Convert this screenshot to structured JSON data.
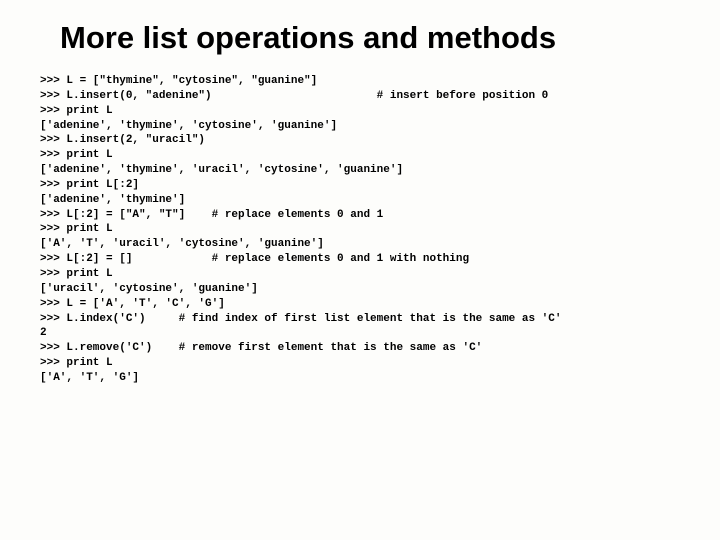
{
  "title": "More list operations and methods",
  "code": ">>> L = [\"thymine\", \"cytosine\", \"guanine\"]\n>>> L.insert(0, \"adenine\")                         # insert before position 0\n>>> print L\n['adenine', 'thymine', 'cytosine', 'guanine']\n>>> L.insert(2, \"uracil\")\n>>> print L\n['adenine', 'thymine', 'uracil', 'cytosine', 'guanine']\n>>> print L[:2]\n['adenine', 'thymine']\n>>> L[:2] = [\"A\", \"T\"]    # replace elements 0 and 1\n>>> print L\n['A', 'T', 'uracil', 'cytosine', 'guanine']\n>>> L[:2] = []            # replace elements 0 and 1 with nothing\n>>> print L\n['uracil', 'cytosine', 'guanine']\n>>> L = ['A', 'T', 'C', 'G']\n>>> L.index('C')     # find index of first list element that is the same as 'C'\n2\n>>> L.remove('C')    # remove first element that is the same as 'C'\n>>> print L\n['A', 'T', 'G']"
}
